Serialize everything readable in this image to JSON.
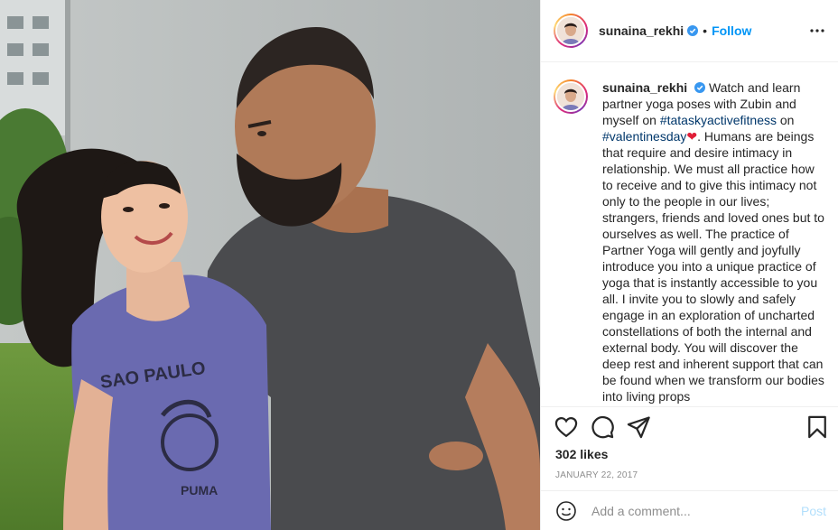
{
  "post": {
    "username": "sunaina_rekhi",
    "follow_label": "Follow",
    "separator": "•",
    "caption": {
      "username": "sunaina_rekhi",
      "part1": "Watch and learn partner yoga poses with Zubin and myself on ",
      "hashtag1": "#tataskyactivefitness",
      "part2": " on ",
      "hashtag2": "#valentinesday",
      "heart": "❤",
      "part3": ". Humans are beings that require and desire intimacy in relationship. We must all practice how to receive and to give this intimacy not only to the people in our lives; strangers, friends and loved ones but to ourselves as well. The practice of Partner Yoga will gently and joyfully introduce you into a unique practice of yoga that is instantly accessible to you all. I invite you to slowly and safely engage in an exploration of uncharted constellations of both the internal and external body. You will discover the deep rest and inherent support that can be found when we transform our bodies into living props"
    },
    "likes": "302 likes",
    "date": "January 22, 2017",
    "comment": {
      "placeholder": "Add a comment...",
      "post_label": "Post"
    },
    "photo_print": {
      "line1": "SAO PAULO",
      "line2": "PUMA"
    }
  },
  "colors": {
    "link_blue": "#0095f6",
    "hashtag": "#00376b",
    "muted": "#8e8e8e",
    "border": "#efefef",
    "verified": "#3897f0",
    "post_disabled": "#b2dffc"
  },
  "icons": [
    "more-options-icon",
    "verified-badge-icon",
    "heart-icon",
    "comment-icon",
    "share-icon",
    "bookmark-icon",
    "emoji-icon"
  ]
}
